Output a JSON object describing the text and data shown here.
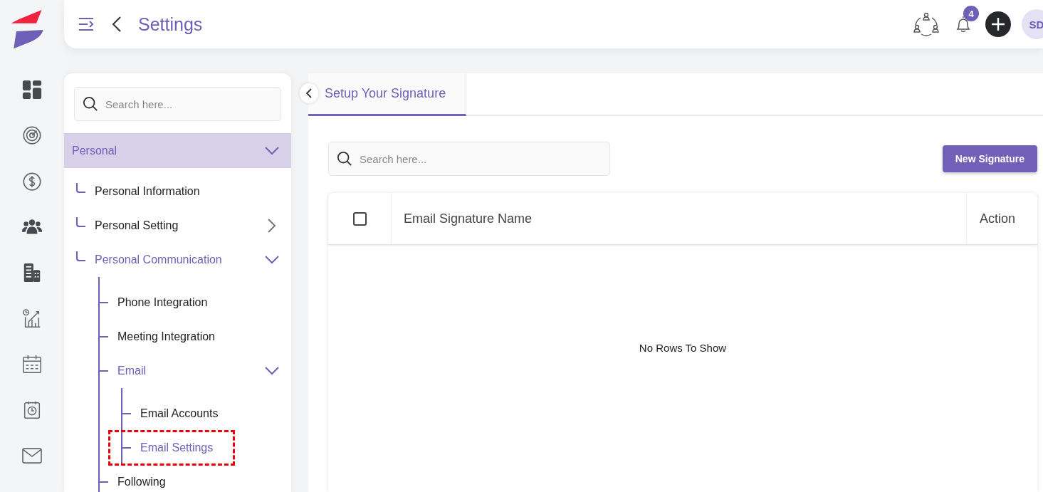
{
  "header": {
    "title": "Settings",
    "notification_count": "4",
    "avatar_initials": "SD"
  },
  "settings_panel": {
    "search": {
      "placeholder": "Search here..."
    },
    "group": {
      "label": "Personal",
      "expanded": true
    },
    "tree": [
      {
        "label": "Personal Information",
        "selected": false
      },
      {
        "label": "Personal Setting",
        "selected": false,
        "expanded": false
      },
      {
        "label": "Personal Communication",
        "selected": false,
        "expanded": true,
        "children": [
          {
            "label": "Phone Integration",
            "selected": false
          },
          {
            "label": "Meeting Integration",
            "selected": false
          },
          {
            "label": "Email",
            "selected": false,
            "expanded": true,
            "children": [
              {
                "label": "Email Accounts",
                "selected": false,
                "highlighted": false
              },
              {
                "label": "Email Settings",
                "selected": true,
                "highlighted": true
              }
            ]
          },
          {
            "label": "Following",
            "selected": false
          }
        ]
      }
    ]
  },
  "tabs": [
    {
      "label": "Setup Your Signature",
      "selected": true
    }
  ],
  "signatures": {
    "search": {
      "placeholder": "Search here..."
    },
    "new_button": "New Signature",
    "table": {
      "select_all_checked": false,
      "columns": [
        "Email Signature Name",
        "Action"
      ],
      "empty_message": "No Rows To Show"
    }
  }
}
